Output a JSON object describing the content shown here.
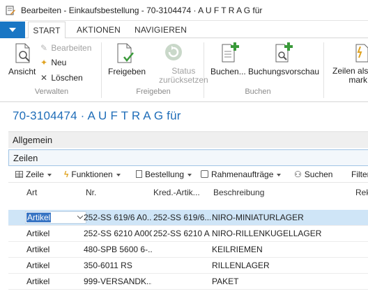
{
  "window": {
    "title": "Bearbeiten - Einkaufsbestellung - 70-3104474 · A U F T R A G für"
  },
  "tabs": [
    "START",
    "AKTIONEN",
    "NAVIGIEREN"
  ],
  "ribbon": {
    "ansicht": "Ansicht",
    "bearbeiten": "Bearbeiten",
    "neu": "Neu",
    "loeschen": "Löschen",
    "group_verwalten": "Verwalten",
    "freigeben": "Freigeben",
    "status_line1": "Status",
    "status_line2": "zurücksetzen",
    "group_freigeben": "Freigeben",
    "buchen": "Buchen...",
    "buchungsvorschau": "Buchungsvorschau",
    "group_buchen": "Buchen",
    "zeilen_line1": "Zeilen als",
    "zeilen_line2": "mark"
  },
  "page": {
    "title": "70-3104474 · A U F T R A G für"
  },
  "sections": {
    "allgemein": "Allgemein",
    "zeilen": "Zeilen"
  },
  "lines_toolbar": {
    "zeile": "Zeile",
    "funktionen": "Funktionen",
    "bestellung": "Bestellung",
    "rahmenauftraege": "Rahmenaufträge",
    "suchen": "Suchen",
    "filter": "Filter"
  },
  "columns": {
    "art": "Art",
    "nr": "Nr.",
    "kred_artik": "Kred.-Artik...",
    "beschreibung": "Beschreibung",
    "rek": "Rek"
  },
  "rows": [
    {
      "art": "Artikel",
      "nr": "252-SS 619/6 A0...",
      "kred": "252-SS 619/6...",
      "beschreibung": "NIRO-MINIATURLAGER"
    },
    {
      "art": "Artikel",
      "nr": "252-SS 6210 A000",
      "kred": "252-SS 6210 A...",
      "beschreibung": "NIRO-RILLENKUGELLAGER"
    },
    {
      "art": "Artikel",
      "nr": "480-SPB 5600 6-...",
      "kred": "",
      "beschreibung": "KEILRIEMEN"
    },
    {
      "art": "Artikel",
      "nr": "350-6011 RS",
      "kred": "",
      "beschreibung": "RILLENLAGER"
    },
    {
      "art": "Artikel",
      "nr": "999-VERSANDK...",
      "kred": "",
      "beschreibung": "PAKET"
    }
  ],
  "colors": {
    "accent": "#1976c4",
    "title_blue": "#1f6db8",
    "selected_row": "#cfe5f7"
  }
}
